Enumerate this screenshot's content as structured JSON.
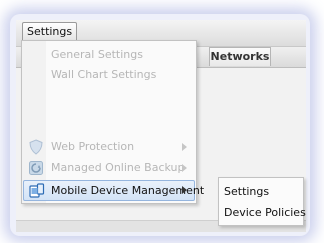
{
  "toolbar": {
    "settings_label": "Settings"
  },
  "tabs": {
    "networks_label": "Networks"
  },
  "menu": {
    "items": [
      {
        "label": "General Settings",
        "icon": null,
        "enabled": false
      },
      {
        "label": "Wall Chart Settings",
        "icon": null,
        "enabled": false
      },
      {
        "label": "",
        "icon": null,
        "enabled": false
      },
      {
        "label": "",
        "icon": null,
        "enabled": false
      },
      {
        "label": "",
        "icon": null,
        "enabled": false
      },
      {
        "label": "Web Protection",
        "icon": "shield-icon",
        "enabled": false,
        "has_submenu": true
      },
      {
        "label": "Managed Online Backup",
        "icon": "backup-icon",
        "enabled": false,
        "has_submenu": true
      },
      {
        "label": "Mobile Device Management",
        "icon": "mobile-device-icon",
        "enabled": true,
        "has_submenu": true,
        "active": true
      }
    ]
  },
  "submenu": {
    "items": [
      {
        "label": "Settings"
      },
      {
        "label": "Device Policies"
      }
    ]
  }
}
